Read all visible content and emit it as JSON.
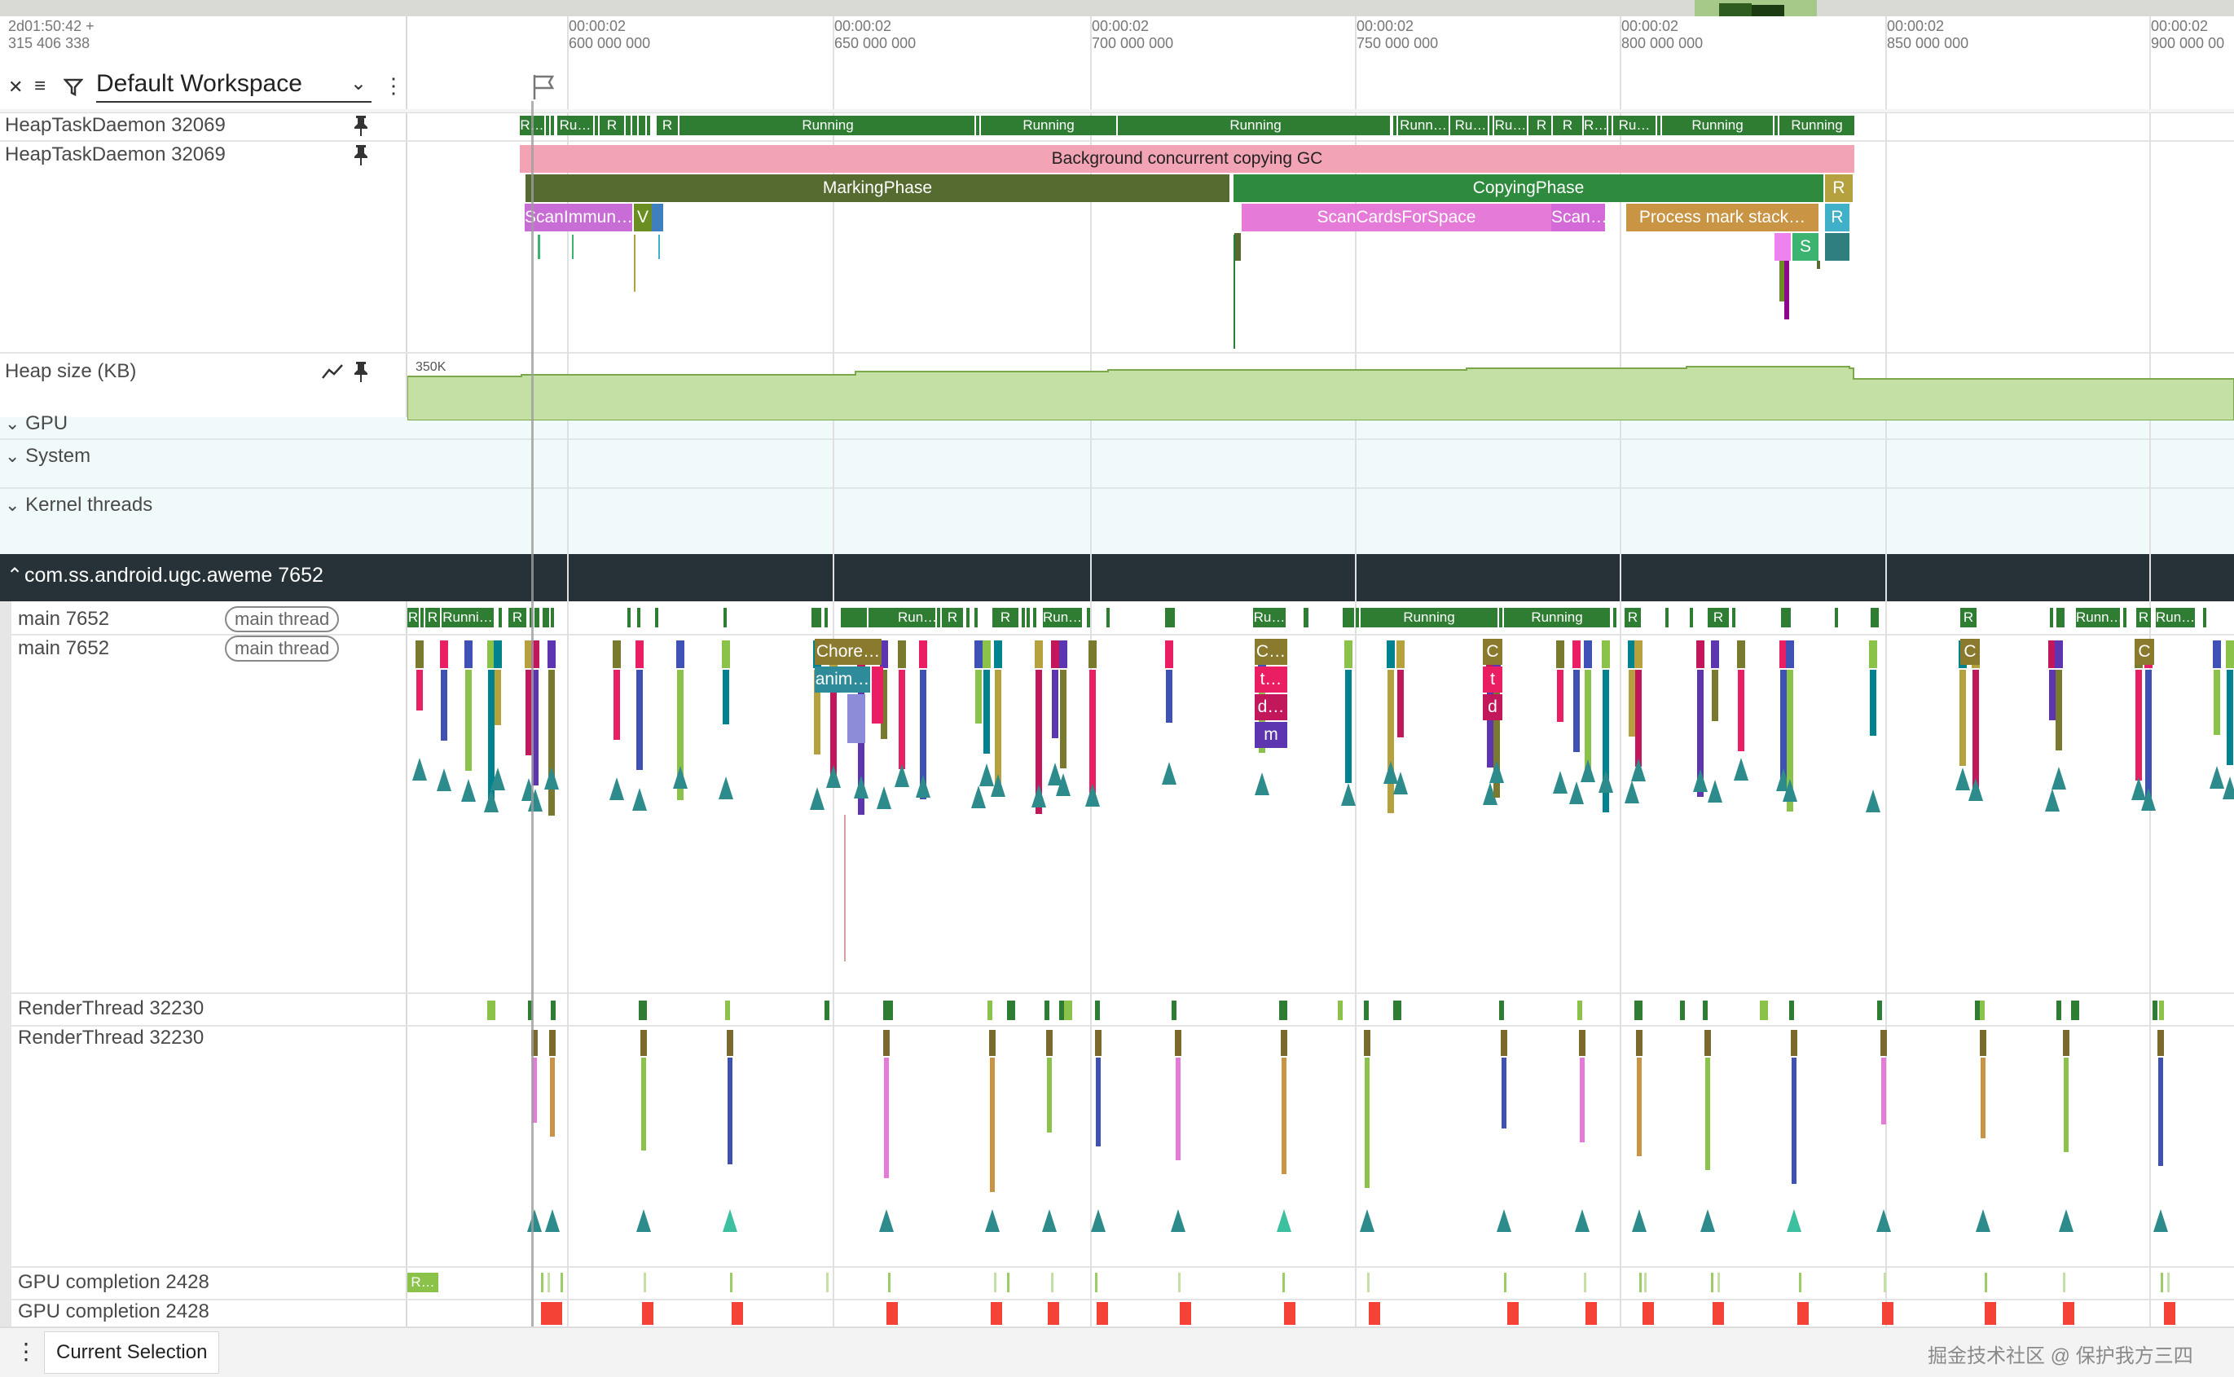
{
  "header": {
    "timestamp_line1": "2d01:50:42  +",
    "timestamp_line2": "315 406 338",
    "workspace_label": "Default Workspace",
    "ticks": [
      {
        "t1": "00:00:02",
        "t2": "600 000 000"
      },
      {
        "t1": "00:00:02",
        "t2": "650 000 000"
      },
      {
        "t1": "00:00:02",
        "t2": "700 000 000"
      },
      {
        "t1": "00:00:02",
        "t2": "750 000 000"
      },
      {
        "t1": "00:00:02",
        "t2": "800 000 000"
      },
      {
        "t1": "00:00:02",
        "t2": "850 000 000"
      },
      {
        "t1": "00:00:02",
        "t2": "900 000 00"
      }
    ]
  },
  "tracks": {
    "heap_daemon_1": "HeapTaskDaemon 32069",
    "heap_daemon_2": "HeapTaskDaemon 32069",
    "heap_size": "Heap size (KB)",
    "heap_scale": "350K",
    "gpu_group": "GPU",
    "system_group": "System",
    "kernel_group": "Kernel threads",
    "process_group": "com.ss.android.ugc.aweme 7652",
    "main_1": "main 7652",
    "main_2": "main 7652",
    "main_badge": "main thread",
    "render_1": "RenderThread 32230",
    "render_2": "RenderThread 32230",
    "gpu_1": "GPU completion 2428",
    "gpu_2": "GPU completion 2428"
  },
  "slices": {
    "gc": "Background concurrent copying GC",
    "marking": "MarkingPhase",
    "copying": "CopyingPhase",
    "scan_immune": "ScanImmun…",
    "v": "V",
    "scan_cards": "ScanCardsForSpace",
    "scan_short": "Scan…",
    "process_mark": "Process mark stack…",
    "r": "R",
    "s": "S",
    "running": "Running",
    "runn": "Runn…",
    "ru": "Ru…",
    "r_dots": "R…",
    "runni": "Runni…",
    "run": "Run…",
    "chore": "Chore…",
    "anim": "anim…",
    "c_dots": "C…",
    "t_dots": "t…",
    "d_dots": "d…",
    "m": "m",
    "c": "C",
    "t": "t",
    "d": "d"
  },
  "footer": {
    "tab_label": "Current Selection",
    "watermark": "掘金技术社区 @ 保护我方三四"
  },
  "colors": {
    "running_green": "#2e7d32",
    "gc_pink": "#f2a3b4",
    "marking_olive": "#556b2f",
    "copying_green": "#2e8b3d",
    "scan_magenta": "#e57ad8",
    "process_orange": "#c99443",
    "heap_fill": "#c5e0a5",
    "process_header": "#263238"
  }
}
